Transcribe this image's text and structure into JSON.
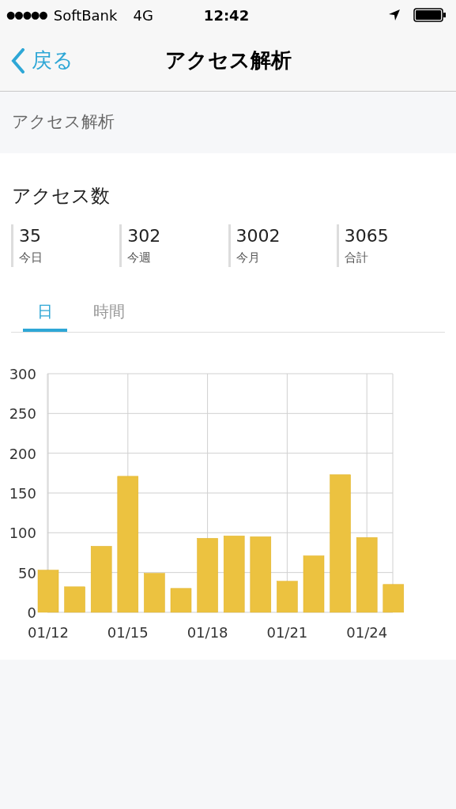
{
  "status_bar": {
    "signal": "●●●●●",
    "carrier": "SoftBank",
    "network": "4G",
    "time": "12:42"
  },
  "nav": {
    "back": "戻る",
    "title": "アクセス解析"
  },
  "section_header": "アクセス解析",
  "card": {
    "title": "アクセス数",
    "stats": [
      {
        "value": "35",
        "label": "今日"
      },
      {
        "value": "302",
        "label": "今週"
      },
      {
        "value": "3002",
        "label": "今月"
      },
      {
        "value": "3065",
        "label": "合計"
      }
    ],
    "tabs": [
      {
        "label": "日",
        "selected": true
      },
      {
        "label": "時間",
        "selected": false
      }
    ],
    "chart_data": {
      "type": "bar",
      "grid": true,
      "ylim": [
        0,
        300
      ],
      "yticks": [
        0,
        50,
        100,
        150,
        200,
        250,
        300
      ],
      "categories": [
        "01/12",
        null,
        null,
        "01/15",
        null,
        null,
        "01/18",
        null,
        null,
        "01/21",
        null,
        null,
        "01/24",
        null
      ],
      "values": [
        53,
        32,
        83,
        171,
        49,
        30,
        93,
        96,
        95,
        39,
        71,
        173,
        94,
        35
      ]
    }
  }
}
